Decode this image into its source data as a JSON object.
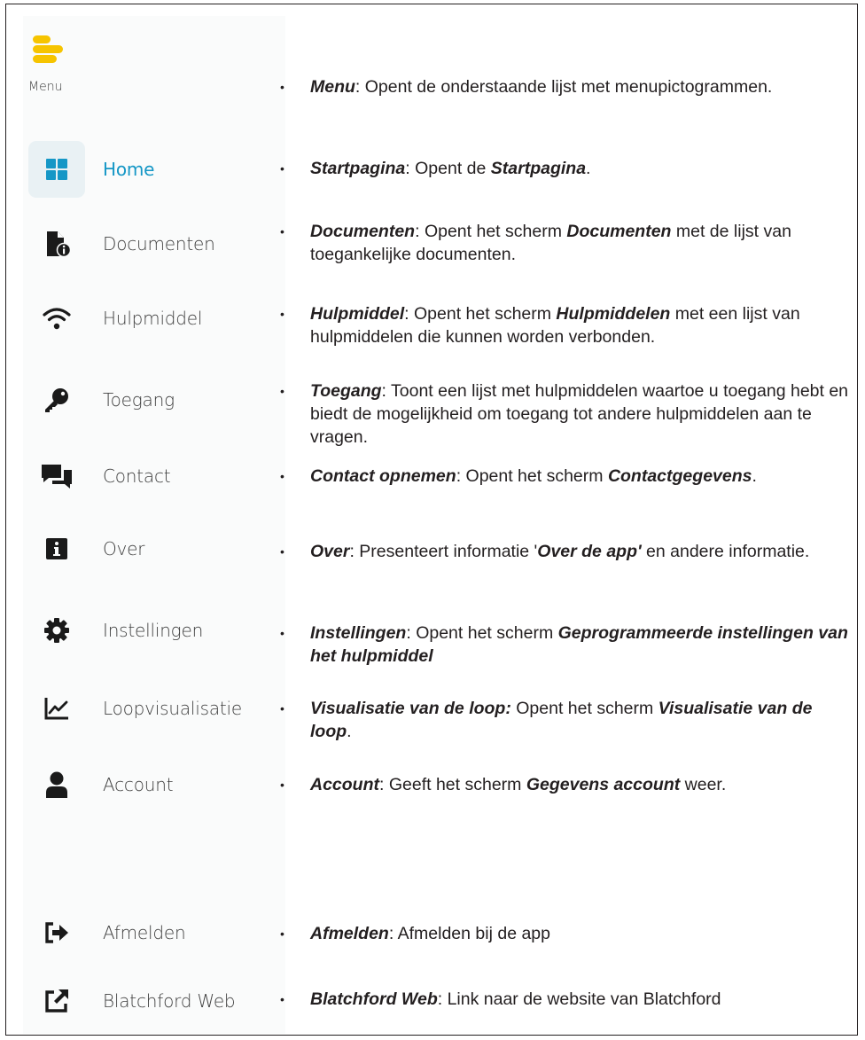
{
  "menu": {
    "toggle_caption": "Menu",
    "toggle_icon": "menu-bars-icon",
    "accent_color": "#f6c400",
    "active_color": "#1597c6",
    "items": [
      {
        "key": "home",
        "label": "Home",
        "icon": "grid-icon",
        "selected": true
      },
      {
        "key": "documenten",
        "label": "Documenten",
        "icon": "document-info-icon"
      },
      {
        "key": "hulpmiddel",
        "label": "Hulpmiddel",
        "icon": "wifi-icon"
      },
      {
        "key": "toegang",
        "label": "Toegang",
        "icon": "key-icon"
      },
      {
        "key": "contact",
        "label": "Contact",
        "icon": "chat-bubbles-icon"
      },
      {
        "key": "over",
        "label": "Over",
        "icon": "info-icon"
      },
      {
        "key": "instellingen",
        "label": "Instellingen",
        "icon": "gear-icon"
      },
      {
        "key": "loopvisualisatie",
        "label": "Loopvisualisatie",
        "icon": "line-chart-icon"
      },
      {
        "key": "account",
        "label": "Account",
        "icon": "person-icon"
      },
      {
        "key": "afmelden",
        "label": "Afmelden",
        "icon": "sign-out-icon"
      },
      {
        "key": "blatchford_web",
        "label": "Blatchford Web",
        "icon": "external-link-icon"
      }
    ]
  },
  "descriptions": {
    "menu": {
      "term": "Menu",
      "text": ": Opent de onderstaande lijst met menupictogrammen."
    },
    "home": {
      "term": "Startpagina",
      "t1": ": Opent de ",
      "term2": "Startpagina",
      "t2": "."
    },
    "documenten": {
      "term": "Documenten",
      "t1": ": Opent het scherm ",
      "term2": "Documenten",
      "t2": " met de lijst van toegankelijke documenten."
    },
    "hulpmiddel": {
      "term": "Hulpmiddel",
      "t1": ": Opent het scherm ",
      "term2": "Hulpmiddelen",
      "t2": " met een lijst van hulpmiddelen die kunnen worden verbonden."
    },
    "toegang": {
      "term": "Toegang",
      "text": ": Toont een lijst met hulpmiddelen waartoe u toegang hebt en biedt de mogelijkheid om toegang tot andere hulpmiddelen aan te vragen."
    },
    "contact": {
      "term": "Contact opnemen",
      "t1": ": Opent het scherm ",
      "term2": "Contactgegevens",
      "t2": "."
    },
    "over": {
      "term": "Over",
      "t1": ": Presenteert informatie '",
      "term2": "Over de app'",
      "t2": " en andere informatie."
    },
    "instellingen": {
      "term": "Instellingen",
      "t1": ": Opent het scherm ",
      "term2": "Geprogrammeerde instellingen van het hulpmiddel",
      "t2": ""
    },
    "loopvisualisatie": {
      "term": "Visualisatie van de loop:",
      "t1": " Opent het scherm ",
      "term2": "Visualisatie van de loop",
      "t2": "."
    },
    "account": {
      "term": "Account",
      "t1": ": Geeft het scherm ",
      "term2": "Gegevens account",
      "t2": " weer."
    },
    "afmelden": {
      "term": "Afmelden",
      "text": ": Afmelden bij de app"
    },
    "blatchford_web": {
      "term": "Blatchford Web",
      "text": ": Link naar de website van Blatchford"
    }
  }
}
